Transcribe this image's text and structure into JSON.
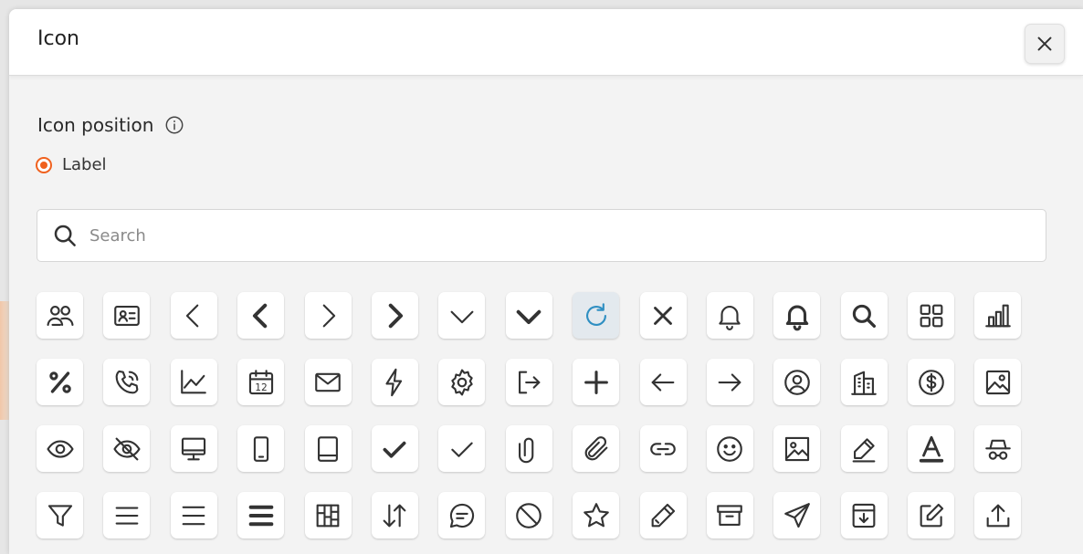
{
  "modal": {
    "title": "Icon",
    "close_icon": "close-icon"
  },
  "position_section": {
    "label": "Icon position",
    "info_icon": "info-icon"
  },
  "radio": {
    "label": "Label",
    "selected": true,
    "accent": "#f0611e"
  },
  "search": {
    "placeholder": "Search",
    "value": ""
  },
  "selected_color": "#2f8fc2",
  "icons": [
    "users-icon",
    "contact-card-icon",
    "chevron-left-icon",
    "chevron-left-bold-icon",
    "chevron-right-icon",
    "chevron-right-bold-icon",
    "chevron-down-icon",
    "chevron-down-bold-icon",
    "refresh-icon",
    "close-icon",
    "bell-icon",
    "bell-bold-icon",
    "search-icon",
    "grid-icon",
    "bar-chart-icon",
    "percent-icon",
    "phone-call-icon",
    "line-chart-icon",
    "calendar-icon",
    "mail-icon",
    "lightning-icon",
    "gear-icon",
    "logout-icon",
    "plus-icon",
    "arrow-left-icon",
    "arrow-right-icon",
    "user-circle-icon",
    "buildings-icon",
    "dollar-circle-icon",
    "image-icon",
    "eye-icon",
    "eye-off-icon",
    "monitor-icon",
    "phone-device-icon",
    "tablet-icon",
    "check-bold-icon",
    "check-icon",
    "paperclip-icon",
    "attachment-icon",
    "link-icon",
    "smiley-icon",
    "image-frame-icon",
    "pencil-line-icon",
    "text-color-icon",
    "incognito-icon",
    "filter-icon",
    "align-lines-icon",
    "menu-lines-icon",
    "menu-bold-icon",
    "layout-board-icon",
    "sort-arrows-icon",
    "chat-icon",
    "ban-icon",
    "star-icon",
    "pencil-icon",
    "archive-icon",
    "send-icon",
    "inbox-download-icon",
    "edit-square-icon",
    "upload-icon"
  ],
  "selected_icon_index": 8
}
